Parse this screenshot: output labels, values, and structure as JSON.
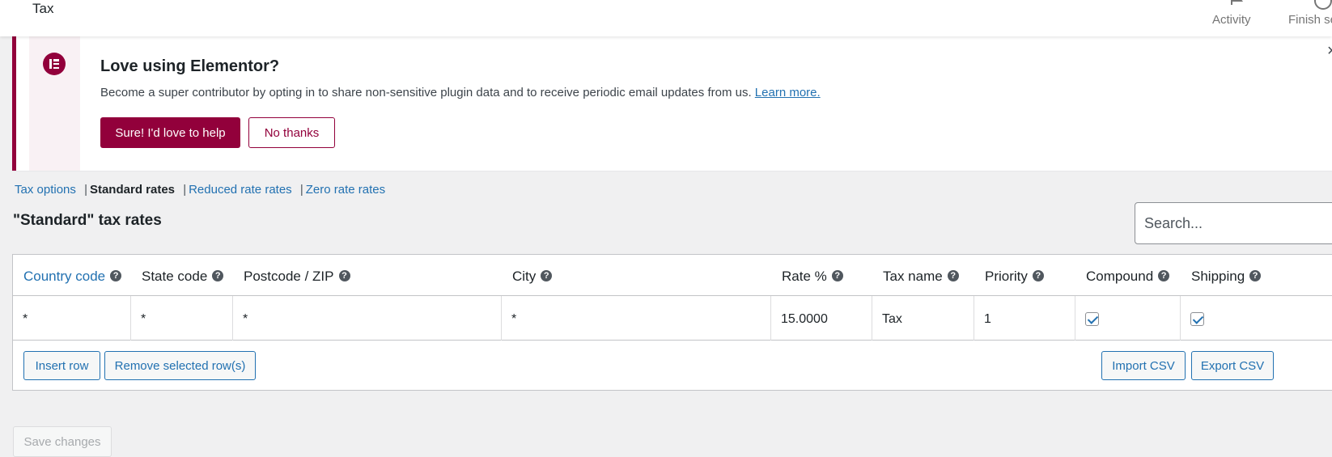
{
  "header": {
    "title": "Tax",
    "actions": [
      {
        "label": "Activity",
        "icon": "flag-icon"
      },
      {
        "label": "Finish se",
        "icon": "progress-circle-icon"
      }
    ]
  },
  "notice": {
    "title": "Love using Elementor?",
    "text": "Become a super contributor by opting in to share non-sensitive plugin data and to receive periodic email updates from us.",
    "link": "Learn more.",
    "primary_button": "Sure! I'd love to help",
    "secondary_button": "No thanks",
    "close": "×",
    "accent_color": "#92003b"
  },
  "subnav": {
    "items": [
      "Tax options",
      "Standard rates",
      "Reduced rate rates",
      "Zero rate rates"
    ],
    "current": "Standard rates",
    "separator": "|"
  },
  "heading": "\"Standard\" tax rates",
  "search": {
    "placeholder": "Search..."
  },
  "table": {
    "columns": [
      "Country code",
      "State code",
      "Postcode / ZIP",
      "City",
      "Rate %",
      "Tax name",
      "Priority",
      "Compound",
      "Shipping"
    ],
    "help_glyph": "?",
    "rows": [
      {
        "country": "*",
        "state": "*",
        "postcode": "*",
        "city": "*",
        "rate": "15.0000",
        "name": "Tax",
        "priority": "1",
        "compound": true,
        "shipping": true
      }
    ],
    "buttons": {
      "insert": "Insert row",
      "remove": "Remove selected row(s)",
      "import": "Import CSV",
      "export": "Export CSV"
    }
  },
  "save_button": "Save changes"
}
